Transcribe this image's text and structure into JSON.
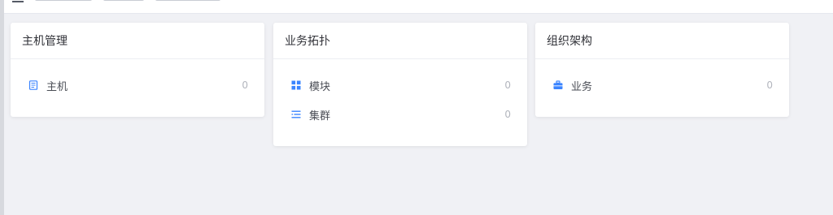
{
  "colors": {
    "accent": "#3a84ff",
    "count": "#b3b6be",
    "background": "#f0f1f5"
  },
  "cards": {
    "host": {
      "title": "主机管理",
      "items": [
        {
          "icon": "document-list-icon",
          "label": "主机",
          "count": "0"
        }
      ]
    },
    "topo": {
      "title": "业务拓扑",
      "items": [
        {
          "icon": "grid-icon",
          "label": "模块",
          "count": "0"
        },
        {
          "icon": "list-indent-icon",
          "label": "集群",
          "count": "0"
        }
      ]
    },
    "org": {
      "title": "组织架构",
      "items": [
        {
          "icon": "briefcase-icon",
          "label": "业务",
          "count": "0"
        }
      ]
    }
  }
}
